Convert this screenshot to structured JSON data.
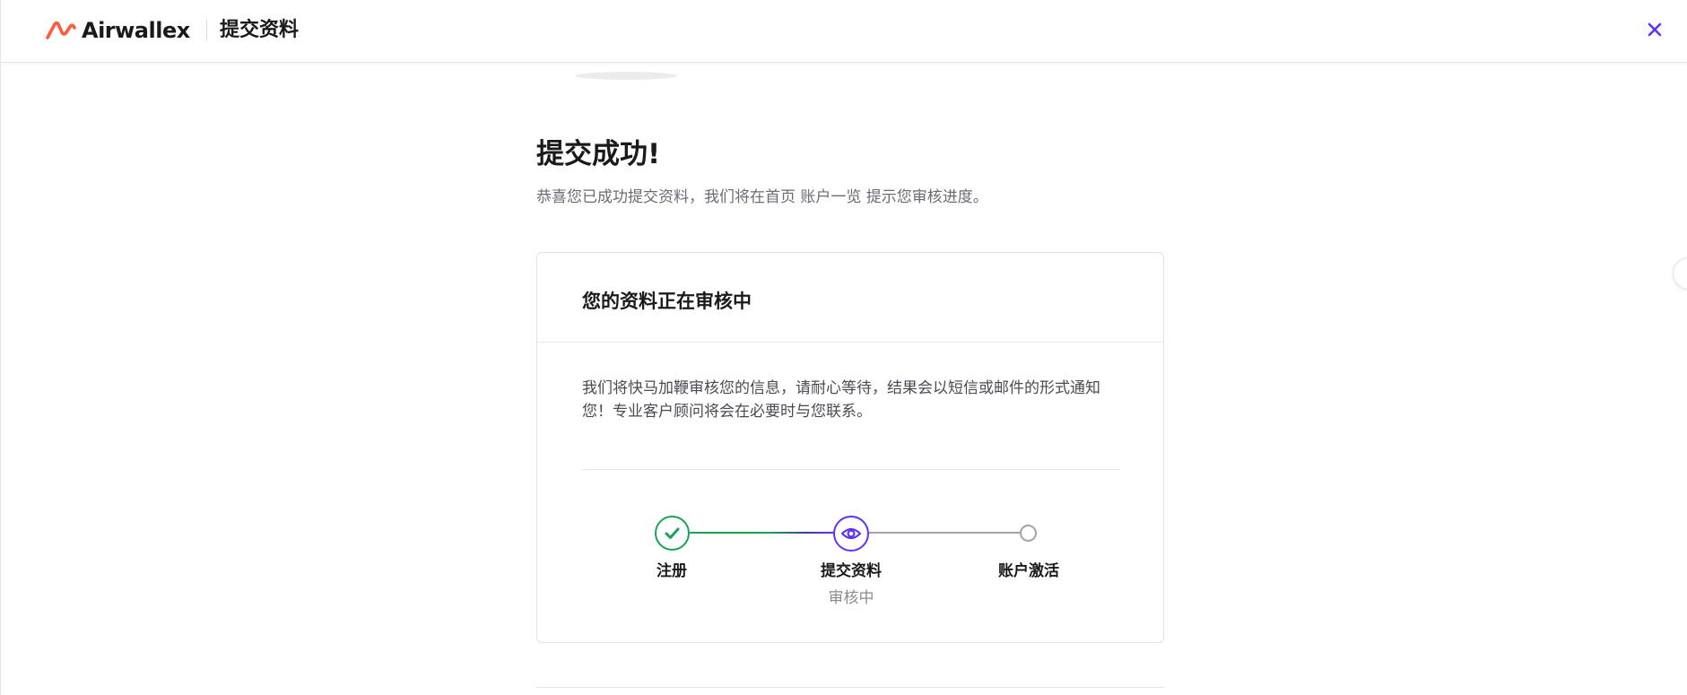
{
  "header": {
    "brand": "Airwallex",
    "title": "提交资料",
    "close_icon": "close-icon"
  },
  "main": {
    "title": "提交成功!",
    "description": "恭喜您已成功提交资料，我们将在首页 账户一览 提示您审核进度。"
  },
  "card": {
    "title": "您的资料正在审核中",
    "body": "我们将快马加鞭审核您的信息，请耐心等待，结果会以短信或邮件的形式通知您！专业客户顾问将会在必要时与您联系。"
  },
  "stepper": {
    "steps": [
      {
        "label": "注册",
        "status": "completed",
        "icon": "check-icon"
      },
      {
        "label": "提交资料",
        "status": "in-review",
        "sub": "审核中",
        "icon": "eye-icon"
      },
      {
        "label": "账户激活",
        "status": "pending",
        "icon": "empty-circle-icon"
      }
    ]
  },
  "colors": {
    "brand_orange": "#FF5A3C",
    "accent_purple": "#612FFF",
    "success_green": "#1AA25B",
    "pending_gray": "#A3A3AE"
  }
}
